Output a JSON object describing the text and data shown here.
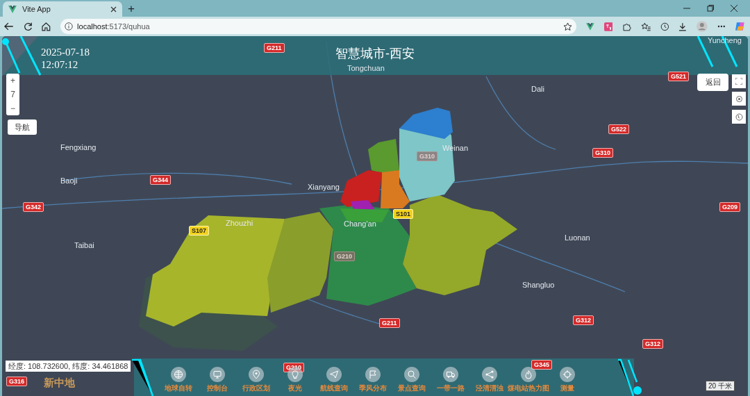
{
  "browser": {
    "tab_title": "Vite App",
    "new_tab": "+",
    "url_host": "localhost",
    "url_path": ":5173/quhua"
  },
  "header": {
    "date": "2025-07-18",
    "time": "12:07:12",
    "title": "智慧城市-西安"
  },
  "zoom_control": {
    "plus": "+",
    "level": "7",
    "minus": "−"
  },
  "nav_button": "导航",
  "back_button": "返回",
  "places": [
    "Tongchuan",
    "Yuncheng",
    "Dali",
    "Fengxiang",
    "Weinan",
    "Baoji",
    "Xianyang",
    "Zhouzhi",
    "Chang'an",
    "Taibai",
    "Luonan",
    "Shangluo"
  ],
  "road_labels": [
    {
      "text": "G211",
      "kind": "national"
    },
    {
      "text": "G521",
      "kind": "national"
    },
    {
      "text": "G522",
      "kind": "national"
    },
    {
      "text": "G310",
      "kind": "national"
    },
    {
      "text": "G310",
      "kind": "faded"
    },
    {
      "text": "G344",
      "kind": "national"
    },
    {
      "text": "G342",
      "kind": "national"
    },
    {
      "text": "G209",
      "kind": "national"
    },
    {
      "text": "S107",
      "kind": "provincial"
    },
    {
      "text": "S101",
      "kind": "provincial"
    },
    {
      "text": "G210",
      "kind": "faded"
    },
    {
      "text": "G211",
      "kind": "national"
    },
    {
      "text": "G312",
      "kind": "national"
    },
    {
      "text": "G312",
      "kind": "national"
    },
    {
      "text": "G210",
      "kind": "national"
    },
    {
      "text": "G345",
      "kind": "national"
    },
    {
      "text": "G316",
      "kind": "national"
    }
  ],
  "coordinates": "经度: 108.732600, 纬度: 34.461868",
  "logo": "新中地",
  "toolbar": [
    "地球自转",
    "控制台",
    "行政区划",
    "夜光",
    "航线查询",
    "季风分布",
    "景点查询",
    "一带一路",
    "泾清渭浊",
    "煤电站热力图",
    "测量"
  ],
  "scale": "20 千米"
}
